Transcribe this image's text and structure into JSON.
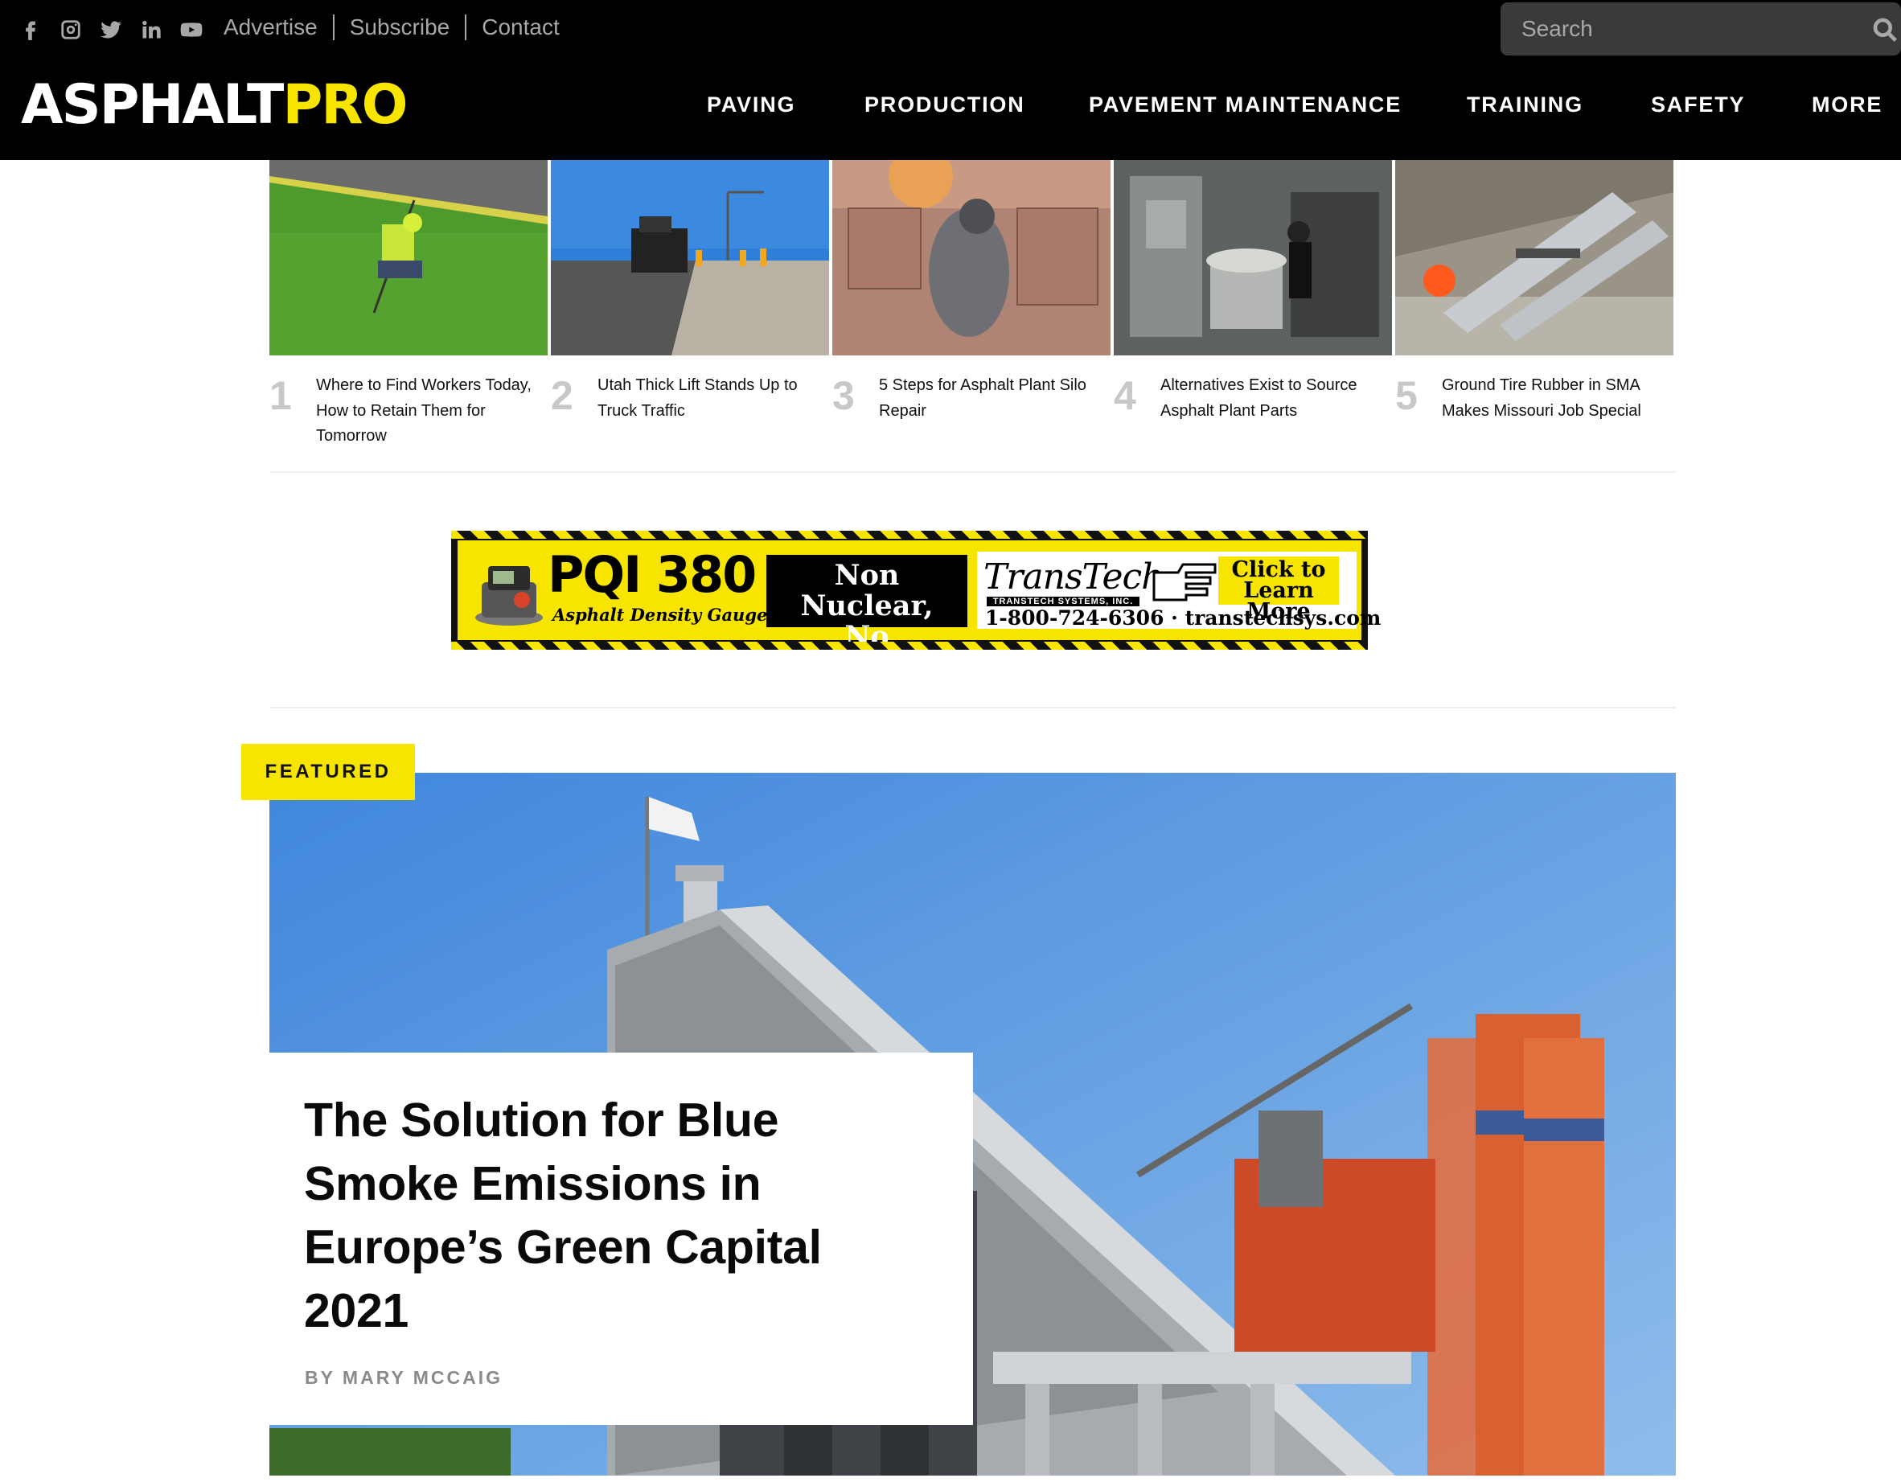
{
  "header": {
    "social": [
      {
        "icon": "facebook-icon"
      },
      {
        "icon": "instagram-icon"
      },
      {
        "icon": "twitter-icon"
      },
      {
        "icon": "linkedin-icon"
      },
      {
        "icon": "youtube-icon"
      }
    ],
    "top_links": {
      "advertise": "Advertise",
      "subscribe": "Subscribe",
      "contact": "Contact"
    },
    "search": {
      "placeholder": "Search",
      "icon": "search-icon"
    },
    "logo": {
      "part1": "ASPHALT",
      "part2": "PRO"
    },
    "nav": {
      "paving": "PAVING",
      "production": "PRODUCTION",
      "pavement_maintenance": "PAVEMENT MAINTENANCE",
      "training": "TRAINING",
      "safety": "SAFETY",
      "more": "MORE"
    }
  },
  "top_stories": [
    {
      "num": "1",
      "title": "Where to Find Workers Today, How to Retain Them for Tomorrow"
    },
    {
      "num": "2",
      "title": "Utah Thick Lift Stands Up to Truck Traffic"
    },
    {
      "num": "3",
      "title": "5 Steps for Asphalt Plant Silo Repair"
    },
    {
      "num": "4",
      "title": "Alternatives Exist to Source Asphalt Plant Parts"
    },
    {
      "num": "5",
      "title": "Ground Tire Rubber in SMA Makes Missouri Job Special"
    }
  ],
  "ad": {
    "product": "PQI 380",
    "product_sub": "Asphalt Density Gauge",
    "claim_line1": "Non Nuclear,",
    "claim_line2": "No Licenses!",
    "brand": "TransTech",
    "brand_sub": "TRANSTECH SYSTEMS, INC.",
    "cta_line1": "Click to",
    "cta_line2": "Learn More",
    "contact": "1-800-724-6306 · transtechsys.com"
  },
  "featured": {
    "badge": "FEATURED",
    "headline": "The Solution for Blue Smoke Emissions in Europe’s Green Capital 2021",
    "byline": "BY MARY MCCAIG"
  },
  "colors": {
    "brand_yellow": "#f7e500",
    "header_bg": "#000000",
    "search_bg": "#3a3a3a",
    "sky_blue": "#4f8fd6"
  }
}
